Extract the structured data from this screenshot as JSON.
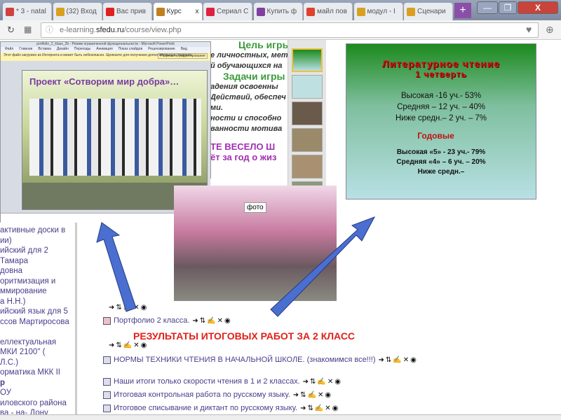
{
  "browser": {
    "tabs": [
      {
        "label": "* 3 - natal",
        "color": "#d04040"
      },
      {
        "label": "(32) Вход",
        "color": "#d9a020"
      },
      {
        "label": "Вас прив",
        "color": "#e02020"
      },
      {
        "label": "Курс",
        "color": "#c08020",
        "active": true
      },
      {
        "label": "Сериал С",
        "color": "#e02040"
      },
      {
        "label": "Купить ф",
        "color": "#8040a0"
      },
      {
        "label": "майл пов",
        "color": "#e04030"
      },
      {
        "label": "модул - І",
        "color": "#d9a020"
      },
      {
        "label": "Сценари",
        "color": "#d9a020"
      }
    ],
    "new_tab": "+",
    "close_tab": "x",
    "minimize": "—",
    "maximize": "❐",
    "close": "X",
    "url_prefix": "e-learning.",
    "url_domain": "sfedu.ru",
    "url_path": "/course/view.php"
  },
  "ppt": {
    "slide_title": "Проект «Сотворим мир добра»…",
    "title_bar": "portfolio_2_klass_2b - Режим ограниченной функциональности - Microsoft PowerPoint",
    "menu": [
      "Файл",
      "Главная",
      "Вставка",
      "Дизайн",
      "Переходы",
      "Анимация",
      "Показ слайдов",
      "Рецензирование",
      "Вид"
    ],
    "notice": "Этот файл загружен из Интернета и может быть небезопасен. Щелкните для получения дополнительных сведений.",
    "notice_btn": "Разрешить редактирование"
  },
  "slide_text": {
    "lines": [
      "Цель игры",
      "е личностных, мет",
      "й обучающихся на",
      "Задачи игры",
      "адения освоенны",
      "Действий, обеспеч",
      "ми.",
      "ности и способно",
      "ванности мотива",
      "ТЕ ВЕСЕЛО Ш",
      "ёт за год о жиз"
    ]
  },
  "results_slide": {
    "title1": "Литературное чтение",
    "title2": "1 четверть",
    "q": [
      "Высокая -16 уч.- 53%",
      "Средняя – 12 уч. – 40%",
      "Ниже средн.– 2 уч. – 7%"
    ],
    "annual_title": "Годовые",
    "y": [
      "Высокая «5» - 23 уч.- 79%",
      "Средняя «4» – 6 уч. – 20%",
      "Ниже средн.–"
    ]
  },
  "photo_label": "фото",
  "sidebar": [
    "активные доски в",
    "ии)",
    "ийский для 2",
    "Тамара",
    "довна",
    "оритмизация и",
    "ммирование",
    "а Н.Н.)",
    "ийский язык для 5",
    "ссов Мартиросова",
    "",
    "еллектуальная",
    "МКИ 2100\" (",
    "Л.С.)",
    "орматика МКК II",
    "р",
    "ОУ",
    "иловского района",
    "ва - на- Дону"
  ],
  "actions": "➜⇅✍✕◉",
  "items": [
    {
      "label": "Портфолио 2 класса."
    },
    {
      "label": "НОРМЫ ТЕХНИКИ ЧТЕНИЯ В НАЧАЛЬНОЙ ШКОЛЕ. (знакомимся все!!!)"
    },
    {
      "label": "Наши итоги только скорости чтения в 1 и 2 классах."
    },
    {
      "label": "Итоговая контрольная работа по русскому языку."
    },
    {
      "label": "Итоговое списывание и диктант по русскому языку."
    }
  ],
  "section_heading": "РЕЗУЛЬТАТЫ ИТОГОВЫХ РАБОТ ЗА 2 КЛАСС",
  "colors": {
    "arrow": "#4a6fd0",
    "heading": "#e0201a",
    "link": "#4a3d8a"
  }
}
